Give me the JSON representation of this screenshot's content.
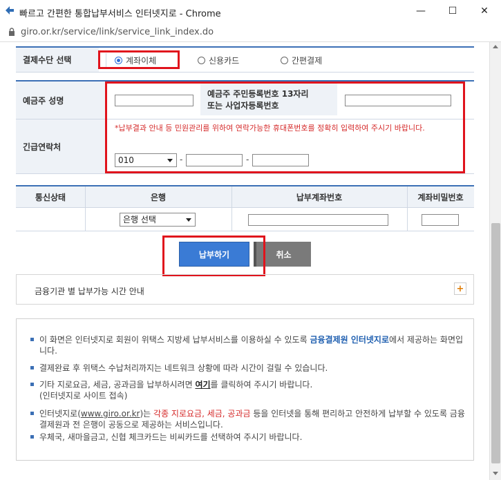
{
  "window": {
    "title": "빠르고 간편한 통합납부서비스 인터넷지로 - Chrome",
    "url": "giro.or.kr/service/link/service_link_index.do",
    "minimize": "—",
    "maximize": "☐",
    "close": "✕"
  },
  "payment_method": {
    "label": "결제수단 선택",
    "options": [
      "계좌이체",
      "신용카드",
      "간편결제"
    ],
    "selected": "계좌이체"
  },
  "depositor": {
    "name_label": "예금주 성명",
    "name_value": "",
    "id_label_line1": "예금주 주민등록번호 13자리",
    "id_label_line2": "또는 사업자등록번호",
    "id_value": ""
  },
  "contact": {
    "label": "긴급연락처",
    "notice": "*납부결과 안내 등 민원관리를 위하여 연락가능한 휴대폰번호를 정확히 입력하여 주시기 바랍니다.",
    "prefix": "010",
    "dash": "-",
    "mid": "",
    "last": ""
  },
  "account_table": {
    "headers": [
      "통신상태",
      "은행",
      "납부계좌번호",
      "계좌비밀번호"
    ],
    "row": {
      "status": "",
      "bank_select": "은행 선택",
      "account": "",
      "password": ""
    }
  },
  "buttons": {
    "pay": "납부하기",
    "cancel": "취소"
  },
  "accordion": {
    "title": "금융기관 별 납부가능 시간 안내",
    "toggle": "+"
  },
  "info": {
    "item1_a": "이 화면은 인터넷지로 회원이 위택스 지방세 납부서비스를 이용하실 수 있도록 ",
    "item1_b": "금융결제원 인터넷지로",
    "item1_c": "에서 제공하는 화면입니다.",
    "item2": "결제완료 후 위택스 수납처리까지는 네트워크 상황에 따라 시간이 걸릴 수 있습니다.",
    "item3_a": "기타 지로요금, 세금, 공과금을 납부하시려면 ",
    "item3_link": "여기",
    "item3_b": "를 클릭하여 주시기 바랍니다.",
    "item3_c": "(인터넷지로 사이트 접속)",
    "item4_a": "인터넷지로(",
    "item4_link": "www.giro.or.kr",
    "item4_b": ")는 ",
    "item4_red": "각종 지로요금, 세금, 공과금",
    "item4_c": " 등을 인터넷을 통해 편리하고 안전하게 납부할 수 있도록 금융결제원과 전 은행이 공동으로 제공하는 서비스입니다.",
    "item5": "우체국, 새마을금고, 신협 체크카드는 비씨카드를 선택하여 주시기 바랍니다."
  },
  "colors": {
    "highlight": "#e0131c",
    "primary": "#3a7bd5",
    "header_bg": "#eef2f7"
  }
}
